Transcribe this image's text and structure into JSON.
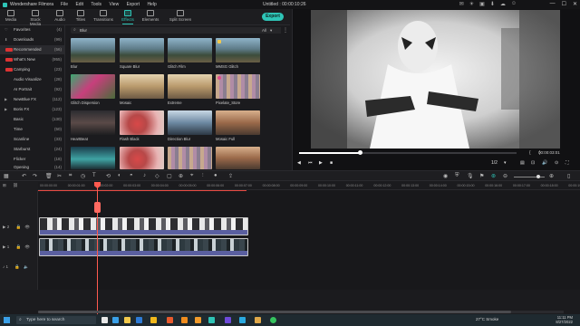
{
  "app": {
    "name": "Wondershare Filmora",
    "menu": [
      "File",
      "Edit",
      "Tools",
      "View",
      "Export",
      "Help"
    ],
    "document_title": "Untitled : 00:00:10:26"
  },
  "toolbar": {
    "tabs": [
      {
        "label": "Media"
      },
      {
        "label": "Stock Media"
      },
      {
        "label": "Audio"
      },
      {
        "label": "Titles"
      },
      {
        "label": "Transitions"
      },
      {
        "label": "Effects"
      },
      {
        "label": "Elements"
      },
      {
        "label": "Split Screen"
      }
    ],
    "active_tab": "Effects",
    "export_label": "Export"
  },
  "sidebar": {
    "items": [
      {
        "label": "Favorites",
        "count": "(4)"
      },
      {
        "label": "Downloads",
        "count": "(99)"
      },
      {
        "label": "Recommended",
        "count": "(56)"
      },
      {
        "label": "What's New",
        "count": "(955)"
      },
      {
        "label": "Camping",
        "count": "(23)"
      },
      {
        "label": "Audio Visualize",
        "count": "(28)"
      },
      {
        "label": "AI Portrait",
        "count": "(92)"
      },
      {
        "label": "NewBlue FX",
        "count": "(112)"
      },
      {
        "label": "Boris FX",
        "count": "(123)"
      },
      {
        "label": "Basic",
        "count": "(130)"
      },
      {
        "label": "Time",
        "count": "(50)"
      },
      {
        "label": "Scanline",
        "count": "(33)"
      },
      {
        "label": "Starburst",
        "count": "(24)"
      },
      {
        "label": "Flicker",
        "count": "(18)"
      },
      {
        "label": "Opening",
        "count": "(14)"
      }
    ]
  },
  "search": {
    "value": "Blur",
    "filter": "All"
  },
  "effects": [
    {
      "label": "Blur"
    },
    {
      "label": "Square Blur"
    },
    {
      "label": "Glitch Film"
    },
    {
      "label": "MMSG Glitch"
    },
    {
      "label": "Glitch Dispersion"
    },
    {
      "label": "Mosaic"
    },
    {
      "label": "Extreme"
    },
    {
      "label": "Pixelate_Store"
    },
    {
      "label": "HeartBeat"
    },
    {
      "label": "Flash Black"
    },
    {
      "label": "Direction Blur"
    },
    {
      "label": "Mosaic Full"
    },
    {
      "label": ""
    },
    {
      "label": ""
    },
    {
      "label": ""
    },
    {
      "label": ""
    }
  ],
  "preview": {
    "timecode": "00:00:03:01",
    "progress": 0.28,
    "quality": "1/2"
  },
  "ruler": {
    "ticks": [
      "00:00:00:00",
      "00:00:01:00",
      "00:00:02:00",
      "00:00:03:00",
      "00:00:04:00",
      "00:00:05:00",
      "00:00:06:00",
      "00:00:07:00",
      "00:00:08:00",
      "00:00:09:00",
      "00:00:10:00",
      "00:00:11:00",
      "00:00:12:00",
      "00:00:13:00",
      "00:00:14:00",
      "00:00:15:00",
      "00:00:16:00",
      "00:00:17:00",
      "00:00:18:00",
      "00:00:19:00",
      "00:00:20:00",
      "00:00:21:00",
      "00:00:22:00",
      "00:00:23:00",
      "00:00:24:00",
      "00:00:25:00",
      "00:00:26:00",
      "00:00:27:00",
      "00:00:28:00",
      "00:00:29:00"
    ]
  },
  "tracks": [
    {
      "label": "▶ 2"
    },
    {
      "label": "▶ 1"
    },
    {
      "label": "♪ 1"
    }
  ],
  "taskbar": {
    "search_placeholder": "Type here to search",
    "weather": "27°C  Smoke",
    "time": "11:11 PM",
    "date": "8/27/2022"
  }
}
